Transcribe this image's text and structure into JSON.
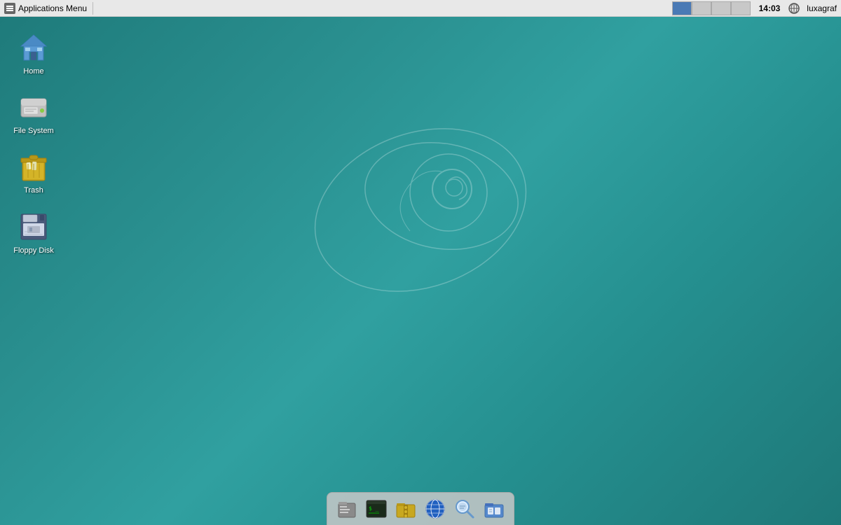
{
  "panel": {
    "apps_menu_label": "Applications Menu",
    "apps_menu_separator": "|",
    "clock": "14:03",
    "user": "luxagraf",
    "workspaces": [
      {
        "id": 1,
        "active": true
      },
      {
        "id": 2,
        "active": false
      },
      {
        "id": 3,
        "active": false
      },
      {
        "id": 4,
        "active": false
      }
    ]
  },
  "desktop": {
    "icons": [
      {
        "id": "home",
        "label": "Home",
        "type": "home"
      },
      {
        "id": "filesystem",
        "label": "File System",
        "type": "filesystem"
      },
      {
        "id": "trash",
        "label": "Trash",
        "type": "trash"
      },
      {
        "id": "floppy",
        "label": "Floppy Disk",
        "type": "floppy"
      }
    ]
  },
  "taskbar": {
    "items": [
      {
        "id": "files",
        "label": "Files",
        "type": "files"
      },
      {
        "id": "terminal",
        "label": "Terminal",
        "type": "terminal"
      },
      {
        "id": "archive",
        "label": "Archive",
        "type": "archive"
      },
      {
        "id": "browser",
        "label": "Browser",
        "type": "browser"
      },
      {
        "id": "search",
        "label": "Search Files",
        "type": "search"
      },
      {
        "id": "filemanager",
        "label": "File Manager",
        "type": "filemanager"
      }
    ]
  }
}
